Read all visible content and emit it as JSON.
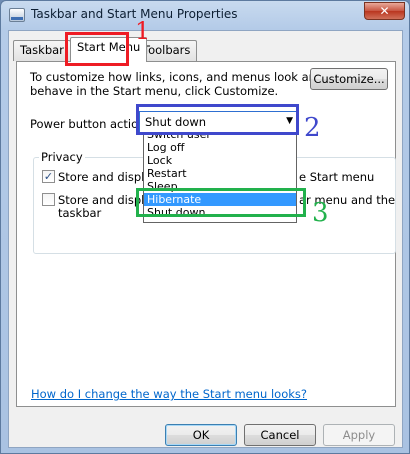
{
  "window": {
    "title": "Taskbar and Start Menu Properties",
    "close_glyph": "✕"
  },
  "tabs": [
    {
      "label": "Taskbar",
      "active": false
    },
    {
      "label": "Start Menu",
      "active": true
    },
    {
      "label": "Toolbars",
      "active": false
    }
  ],
  "panel": {
    "intro_line1": "To customize how links, icons, and menus look and",
    "intro_line2": "behave in the Start menu, click Customize.",
    "customize_label": "Customize...",
    "power_label": "Power button action:",
    "power_value": "Shut down",
    "power_arrow_glyph": "▼",
    "power_options": [
      "Switch user",
      "Log off",
      "Lock",
      "Restart",
      "Sleep",
      "Hibernate",
      "Shut down"
    ],
    "power_highlighted": "Hibernate",
    "privacy_label": "Privacy",
    "privacy_items": [
      {
        "text_left": "Store and display r",
        "text_right": "e Start menu",
        "checked": true
      },
      {
        "text_left": "Store and display",
        "text_right": "ar menu and the",
        "text_line2": "taskbar",
        "checked": false
      }
    ],
    "check_glyph": "✓",
    "help_link": "How do I change the way the Start menu looks?"
  },
  "footer": {
    "ok_label": "OK",
    "cancel_label": "Cancel",
    "apply_label": "Apply"
  },
  "annotations": {
    "colors": {
      "one": "#ee1c24",
      "two": "#3f48cc",
      "three": "#22b14c"
    },
    "labels": [
      "1",
      "2",
      "3"
    ]
  }
}
